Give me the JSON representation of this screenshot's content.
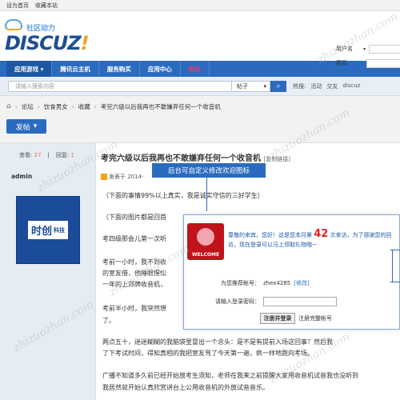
{
  "topbar": {
    "set_home": "设为首页",
    "bookmark": "收藏本站"
  },
  "logo": {
    "main": "DISCUZ",
    "excl": "!",
    "sub": "社区动力"
  },
  "login": {
    "username_label": "用户名",
    "username_dropdown": "▾",
    "password_label": "密码"
  },
  "nav": {
    "items": [
      {
        "label": "应用游戏 ▾"
      },
      {
        "label": "腾讯云主机"
      },
      {
        "label": "服务购买"
      },
      {
        "label": "应用中心"
      },
      {
        "label": "积分"
      }
    ]
  },
  "search": {
    "placeholder": "请输入搜索内容",
    "category": "帖子",
    "category_arrow": "▾",
    "button_icon": "🔍",
    "hot_label": "热搜:",
    "hot_words": [
      "活动",
      "交友",
      "discuz"
    ]
  },
  "breadcrumb": {
    "items": [
      "论坛",
      "饮食男女",
      "收藏",
      "考完六级以后我再也不敢嫌弃任何一个收音机"
    ]
  },
  "post_button": {
    "label": "发帖",
    "arrow": "▾"
  },
  "stats": {
    "views_label": "查看:",
    "views": "27",
    "replies_label": "回复:",
    "replies": "1"
  },
  "thread": {
    "title": "考完六级以后我再也不敢嫌弃任何一个收音机",
    "copy_link": "[复制链接]"
  },
  "author": {
    "name": "admin",
    "avatar_text_big": "时创",
    "avatar_text_small": "科技"
  },
  "post": {
    "meta": "发表于 2014-",
    "paragraphs": [
      "（下面的事情99%以上真实，我是诚实守信的三好学生）",
      "（下面的图片都是回首",
      "考四级那会儿第一次听",
      "考前一小时，我不到收",
      "的室友借，他睡眼惺忪",
      "一年的上郊牌收音机，",
      "考前半小时，我突然想",
      "了。",
      "两点五十，迷迷糊糊的我脑袋里冒出一个念头：是不是有提前入场这回事？然后我",
      "了下考试时间，得知真相的我把室友骂了今天第一遍，疯一样地跑向考场。",
      "广播不知道多久前已经开始放考生须知，老师在我来之前提醒大家用收音机试音我也没听到",
      "我居然就开始认真欣赏讲台上公用收音机的外放试音音乐。"
    ]
  },
  "tooltip": {
    "text": "后台可自定义修改欢迎图标"
  },
  "popup": {
    "image_word": "WELCOME",
    "msg_pre": "尊敬的来宾，您好！这是您本月第",
    "visit_count": "42",
    "msg_post": "次来访，为了感谢您的回访，现在登录可以马上领取礼物哦~",
    "recommend_label": "为您推荐帐号：",
    "recommend_value": "zhex4285",
    "modify_link": "[修改]",
    "password_label": "请输入登录密码：",
    "register_button": "注册并登录",
    "full_register_link": "注册完整帐号"
  },
  "watermark": {
    "text": "zhizuozhan.com"
  }
}
